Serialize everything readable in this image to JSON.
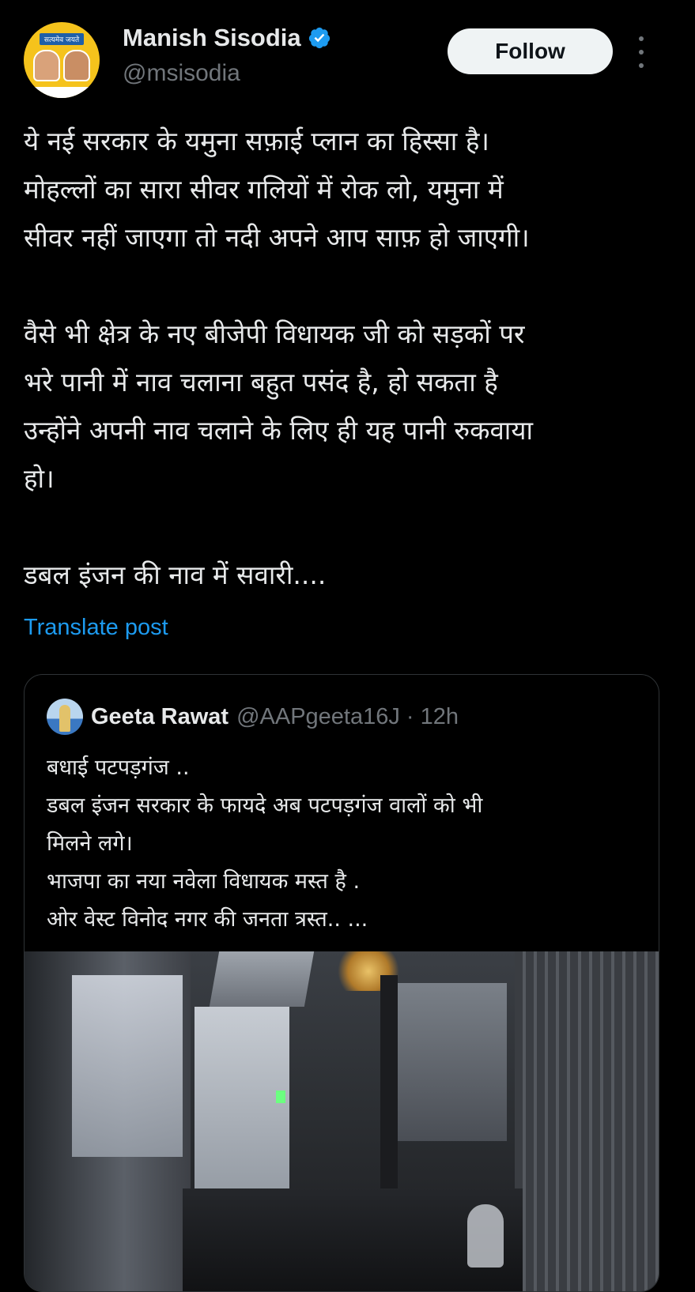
{
  "author": {
    "name": "Manish Sisodia",
    "handle": "@msisodia",
    "verified": true,
    "avatar_banner_text": "सत्यमेव जयते"
  },
  "follow_label": "Follow",
  "post": {
    "lines_block1": [
      "ये नई सरकार के यमुना सफ़ाई प्लान का हिस्सा है।",
      "मोहल्लों का सारा सीवर गलियों में रोक लो, यमुना में",
      "सीवर नहीं जाएगा तो नदी अपने आप साफ़ हो जाएगी।"
    ],
    "lines_block2": [
      "वैसे भी क्षेत्र के नए बीजेपी विधायक जी को सड़कों पर",
      "भरे पानी में नाव चलाना बहुत पसंद है, हो सकता है",
      "उन्होंने अपनी नाव चलाने के लिए ही यह पानी रुकवाया",
      "हो।"
    ],
    "line_block3": "डबल इंजन की नाव में सवारी...."
  },
  "translate_label": "Translate post",
  "quoted": {
    "name": "Geeta Rawat",
    "handle_time": "@AAPgeeta16J · 12h",
    "lines": [
      "बधाई पटपड़गंज ..",
      "डबल इंजन सरकार के फायदे अब पटपड़गंज वालों को भी",
      "मिलने लगे।",
      "भाजपा का नया नवेला विधायक मस्त है .",
      "ओर वेस्ट विनोद नगर की जनता त्रस्त.. ..."
    ]
  },
  "colors": {
    "background": "#000000",
    "text": "#e7e9ea",
    "muted": "#71767b",
    "link": "#1d9bf0",
    "verified": "#1d9bf0",
    "border": "#2f3336"
  }
}
